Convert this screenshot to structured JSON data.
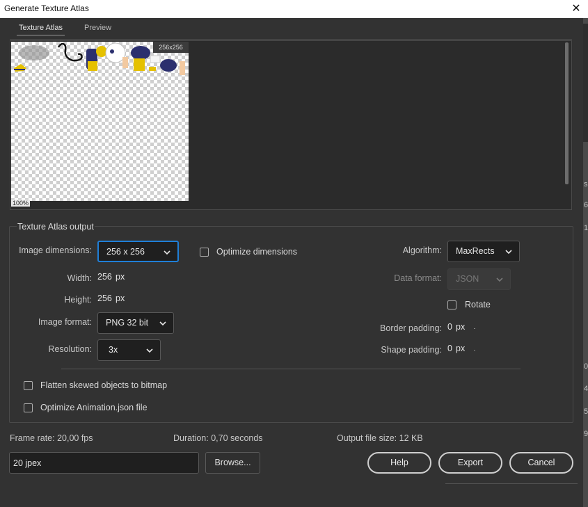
{
  "window": {
    "title": "Generate Texture Atlas",
    "close_glyph": "✕"
  },
  "tabs": [
    {
      "label": "Texture Atlas",
      "active": true
    },
    {
      "label": "Preview",
      "active": false
    }
  ],
  "preview": {
    "size_badge": "256x256",
    "zoom": "100%"
  },
  "section": {
    "title": "Texture Atlas output"
  },
  "left": {
    "image_dimensions_label": "Image dimensions:",
    "image_dimensions_value": "256 x 256",
    "width_label": "Width:",
    "width_value": "256",
    "height_label": "Height:",
    "height_value": "256",
    "unit_px": "px",
    "image_format_label": "Image format:",
    "image_format_value": "PNG 32 bit",
    "resolution_label": "Resolution:",
    "resolution_value": "3x"
  },
  "optimize_dimensions": {
    "label": "Optimize dimensions",
    "checked": false
  },
  "right": {
    "algorithm_label": "Algorithm:",
    "algorithm_value": "MaxRects",
    "data_format_label": "Data format:",
    "data_format_value": "JSON",
    "rotate_label": "Rotate",
    "rotate_checked": false,
    "border_padding_label": "Border padding:",
    "border_padding_value": "0",
    "shape_padding_label": "Shape padding:",
    "shape_padding_value": "0",
    "unit_px": "px"
  },
  "options": [
    {
      "label": "Flatten skewed objects to bitmap",
      "checked": false
    },
    {
      "label": "Optimize Animation.json file",
      "checked": false
    }
  ],
  "info": {
    "frame_rate": "Frame rate: 20,00 fps",
    "duration": "Duration: 0,70 seconds",
    "output_size": "Output file size: 12 KB"
  },
  "output": {
    "path_value": "20 jpex",
    "browse_label": "Browse..."
  },
  "buttons": {
    "help": "Help",
    "export": "Export",
    "cancel": "Cancel"
  },
  "right_strip_fragments": [
    "se",
    "6",
    "1",
    "0",
    "4",
    "5",
    "9"
  ],
  "colors": {
    "focus_blue": "#1f7fd8",
    "sprite_navy": "#2b2f6e",
    "sprite_gold": "#e5c100"
  }
}
